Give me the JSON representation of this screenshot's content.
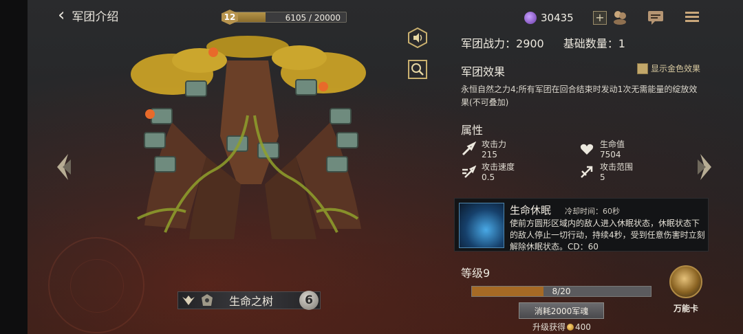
{
  "header": {
    "back_title": "军团介绍",
    "level": "12",
    "exp_text": "6105 / 20000",
    "exp_current": 6105,
    "exp_max": 20000,
    "currency": "30435",
    "plus": "+"
  },
  "hero": {
    "name": "生命之树",
    "count": "6"
  },
  "stats": {
    "power_label": "军团战力：",
    "power_value": "2900",
    "base_label": "基础数量：",
    "base_value": "1"
  },
  "effect": {
    "title": "军团效果",
    "gold_toggle": "显示金色效果",
    "desc": "永恒自然之力4;所有军团在回合结束时发动1次无需能量的绽放效果(不可叠加)"
  },
  "attributes": {
    "title": "属性",
    "items": [
      {
        "label": "攻击力",
        "value": "215",
        "icon": "attack-icon"
      },
      {
        "label": "生命值",
        "value": "7504",
        "icon": "heart-icon"
      },
      {
        "label": "攻击速度",
        "value": "0.5",
        "icon": "attack-speed-icon"
      },
      {
        "label": "攻击范围",
        "value": "5",
        "icon": "range-icon"
      }
    ]
  },
  "skill": {
    "name": "生命休眠",
    "cooldown": "冷却时间：60秒",
    "desc": "使前方圆形区域内的敌人进入休眠状态，休眠状态下的敌人停止一切行动，持续4秒，受到任意伤害时立刻解除休眠状态。CD：60"
  },
  "level": {
    "title": "等级9",
    "xp_text": "8/20",
    "xp_current": 8,
    "xp_max": 20,
    "upgrade_button": "消耗2000军魂",
    "reward_prefix": "升级获得",
    "reward_amount": "400"
  },
  "wild_card": {
    "label": "万能卡"
  },
  "colors": {
    "accent_gold": "#b7944e",
    "xp_fill": "#a66a25",
    "panel_bg": "#232426"
  }
}
